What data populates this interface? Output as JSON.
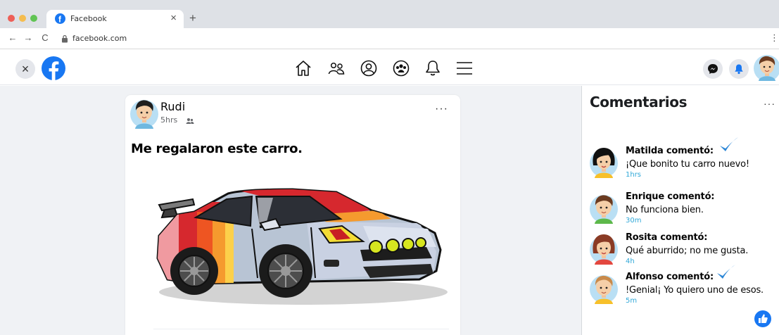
{
  "browser": {
    "tab_title": "Facebook",
    "tab_close": "×",
    "new_tab": "+",
    "url": "facebook.com",
    "back": "←",
    "forward": "→",
    "reload": "C",
    "menu": "⋮"
  },
  "header": {
    "close": "×",
    "nav_icons": [
      "home-icon",
      "friends-icon",
      "profile-icon",
      "groups-icon",
      "bell-icon",
      "menu-icon"
    ],
    "right_icons": [
      "messenger-icon",
      "notifications-icon",
      "avatar"
    ]
  },
  "post": {
    "author": "Rudi",
    "time": "5hrs",
    "more": "···",
    "text": "Me regalaron este carro."
  },
  "comments_panel": {
    "title": "Comentarios",
    "more": "···",
    "items": [
      {
        "author": "Matilda comentó:",
        "text": "¡Que bonito tu carro nuevo!",
        "time": "1hrs",
        "checked": true
      },
      {
        "author": "Enrique comentó:",
        "text": "No funciona bien.",
        "time": "30m",
        "checked": false
      },
      {
        "author": "Rosita comentó:",
        "text": "Qué aburrido; no me gusta.",
        "time": "4h",
        "checked": false
      },
      {
        "author": "Alfonso comentó:",
        "text": "!Genial¡ Yo quiero uno de esos.",
        "time": "5m",
        "checked": true
      }
    ]
  },
  "colors": {
    "facebook_blue": "#1877f2",
    "timestamp_blue": "#30a8d8",
    "page_bg": "#f0f2f5"
  }
}
